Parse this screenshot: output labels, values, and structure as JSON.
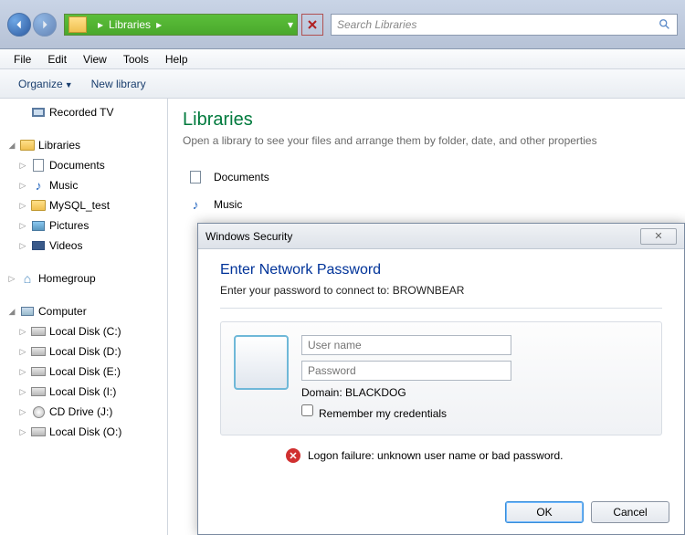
{
  "nav": {
    "breadcrumb": "Libraries",
    "search_placeholder": "Search Libraries"
  },
  "menubar": [
    "File",
    "Edit",
    "View",
    "Tools",
    "Help"
  ],
  "toolbar": {
    "organize": "Organize",
    "newlib": "New library"
  },
  "sidebar": {
    "recorded_tv": "Recorded TV",
    "libraries": "Libraries",
    "lib_items": [
      "Documents",
      "Music",
      "MySQL_test",
      "Pictures",
      "Videos"
    ],
    "homegroup": "Homegroup",
    "computer": "Computer",
    "drives": [
      "Local Disk (C:)",
      "Local Disk (D:)",
      "Local Disk (E:)",
      "Local Disk (I:)",
      "CD Drive (J:)",
      "Local Disk (O:)"
    ]
  },
  "main": {
    "title": "Libraries",
    "subtitle": "Open a library to see your files and arrange them by folder, date, and other properties",
    "items": [
      "Documents",
      "Music"
    ]
  },
  "dialog": {
    "title": "Windows Security",
    "heading": "Enter Network Password",
    "subtitle": "Enter your password to connect to: BROWNBEAR",
    "user_placeholder": "User name",
    "pass_placeholder": "Password",
    "domain": "Domain: BLACKDOG",
    "remember": "Remember my credentials",
    "error": "Logon failure: unknown user name or bad password.",
    "ok": "OK",
    "cancel": "Cancel"
  }
}
